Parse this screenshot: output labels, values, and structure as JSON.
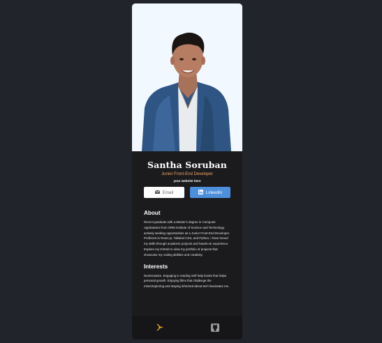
{
  "profile": {
    "name": "Santha Soruban",
    "role": "Junior Front-End Developer",
    "website_note": "your website here"
  },
  "buttons": {
    "email": {
      "label": "Email",
      "icon": "envelope-icon"
    },
    "linkedin": {
      "label": "LinkedIn",
      "icon": "linkedin-icon"
    }
  },
  "about": {
    "heading": "About",
    "text": "Recent graduate with a Master's degree in Computer Applications from SRM Institute of Science and Technology, actively seeking opportunities as a Junior Front-End Developer. Proficient in React.js, Tailwind CSS, and Python, I have honed my skills through academic projects and hands-on experience. Explore my GitHub to view my portfolio of projects that showcase my coding abilities and creativity."
  },
  "interests": {
    "heading": "Interests",
    "text": "Numismatics. Engaging in reading Self help books that helps personal growth. Enjoying films that challenge the mind.Exploring and staying informed about tech fascinates me."
  },
  "footer": {
    "icons": [
      "brand-icon",
      "github-icon"
    ]
  },
  "colors": {
    "page_background": "#22242b",
    "card_background": "#1b1b1e",
    "accent_orange": "#f5a662",
    "linkedin_blue": "#4d8fdb",
    "photo_background": "#f1f8ff"
  }
}
